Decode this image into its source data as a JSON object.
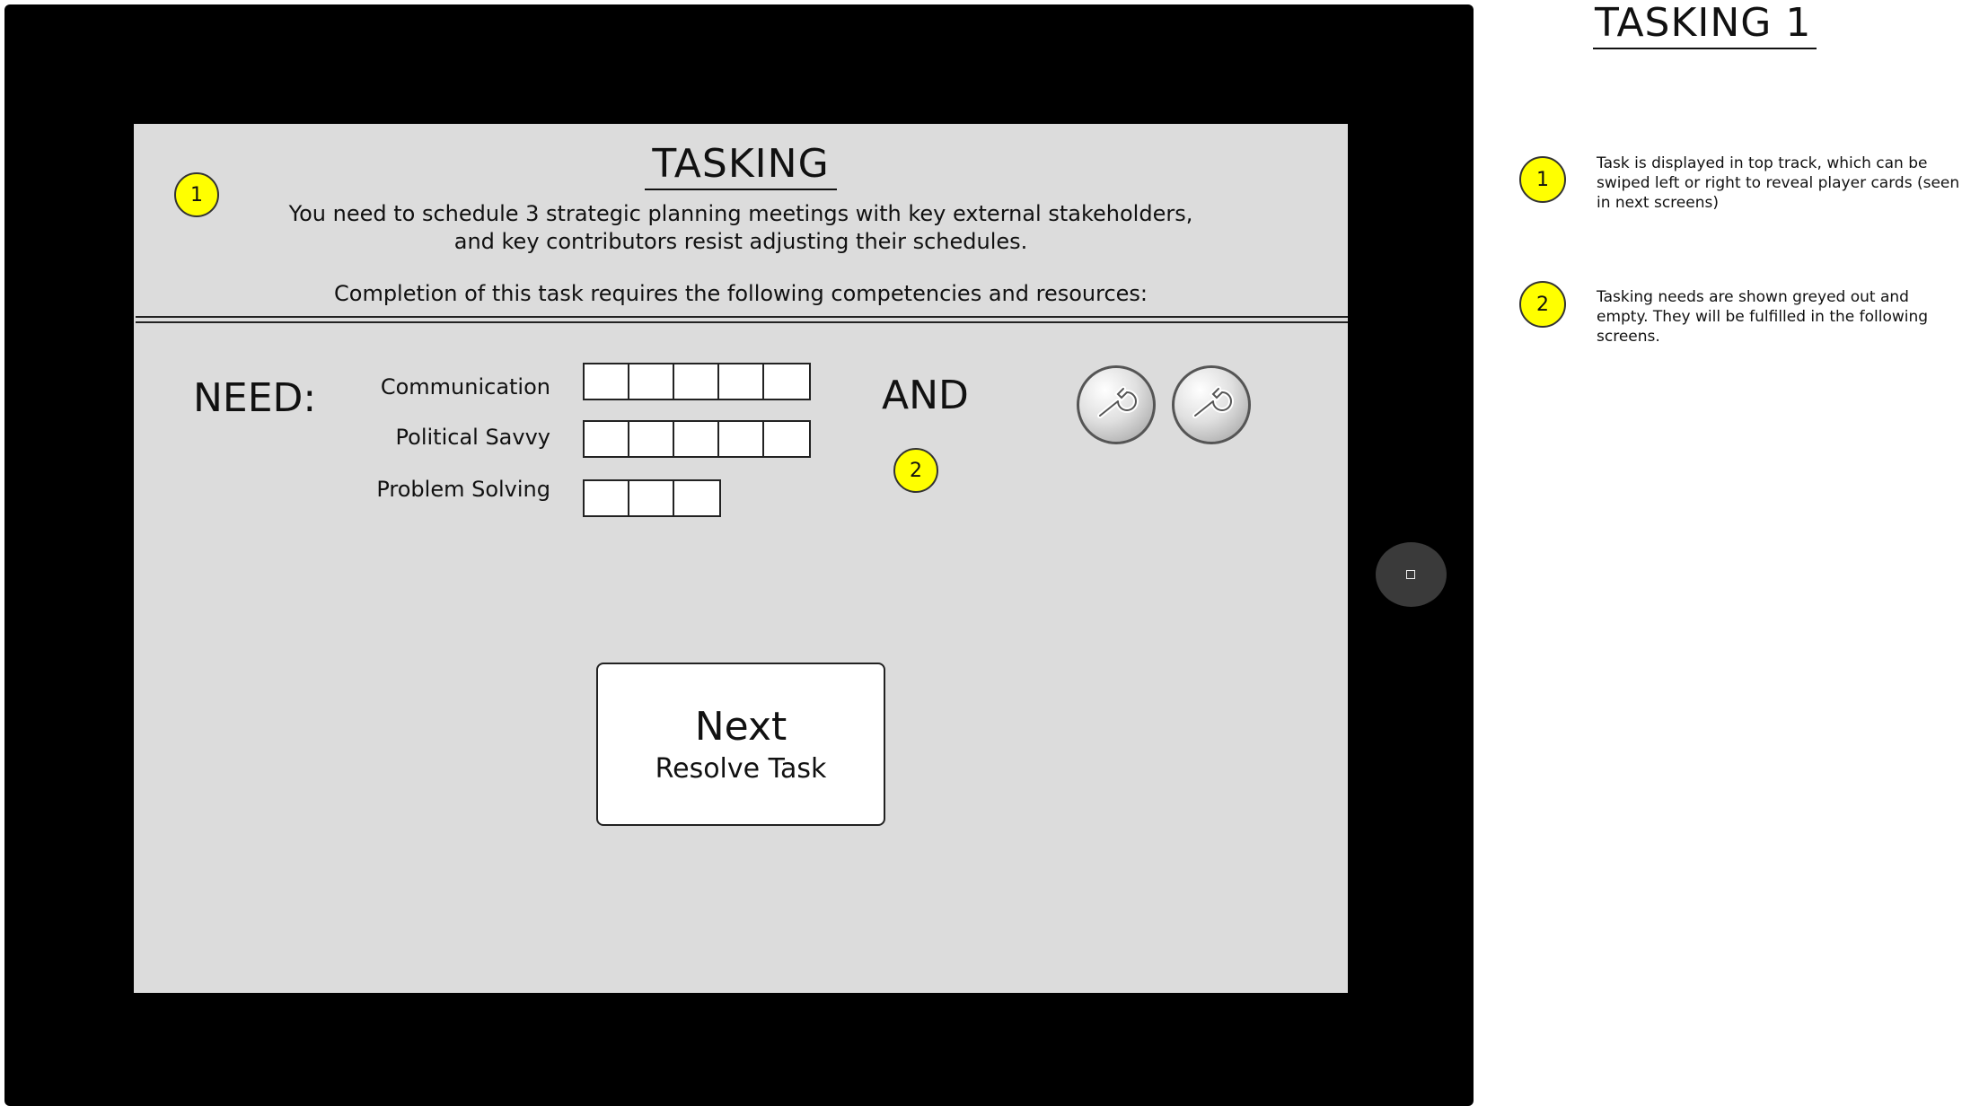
{
  "tablet": {
    "screen": {
      "title": "TASKING",
      "description_lines": [
        "You need to schedule 3 strategic planning meetings with key external stakeholders,",
        "and key contributors resist adjusting their schedules."
      ],
      "requirement_text": "Completion of this task requires the following competencies and resources:",
      "need_label": "NEED:",
      "and_label": "AND",
      "competencies": [
        {
          "label": "Communication",
          "slots": 5
        },
        {
          "label": "Political Savvy",
          "slots": 5
        },
        {
          "label": "Problem Solving",
          "slots": 3
        }
      ],
      "resources": [
        {
          "icon": "wrench-icon"
        },
        {
          "icon": "wrench-icon"
        }
      ],
      "next_button": {
        "main": "Next",
        "sub": "Resolve Task"
      },
      "badges": {
        "one": "1",
        "two": "2"
      }
    }
  },
  "annotations": {
    "title": "TASKING 1",
    "notes": [
      {
        "number": "1",
        "text": "Task is displayed in top track, which can be swiped left or right to reveal player cards (seen in next screens)"
      },
      {
        "number": "2",
        "text": "Tasking needs are shown greyed out and empty. They will be fulfilled in the following screens."
      }
    ]
  },
  "colors": {
    "badge": "#ffff00",
    "screen_background": "#dcdcdc",
    "tablet_frame": "#000000"
  }
}
